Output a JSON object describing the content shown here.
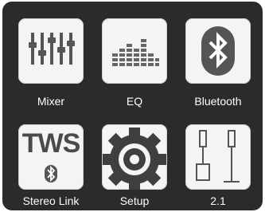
{
  "menu": {
    "items": [
      {
        "label": "Mixer",
        "icon": "mixer-sliders-icon"
      },
      {
        "label": "EQ",
        "icon": "equalizer-bars-icon"
      },
      {
        "label": "Bluetooth",
        "icon": "bluetooth-icon"
      },
      {
        "label": "Stereo Link",
        "icon": "tws-icon",
        "icon_text": "TWS"
      },
      {
        "label": "Setup",
        "icon": "gear-icon"
      },
      {
        "label": "2.1",
        "icon": "speakers-2-1-icon"
      }
    ]
  },
  "colors": {
    "background": "#2b2b2b",
    "tile": "#f4f4f4",
    "icon": "#4a4a4a",
    "text": "#ffffff"
  }
}
